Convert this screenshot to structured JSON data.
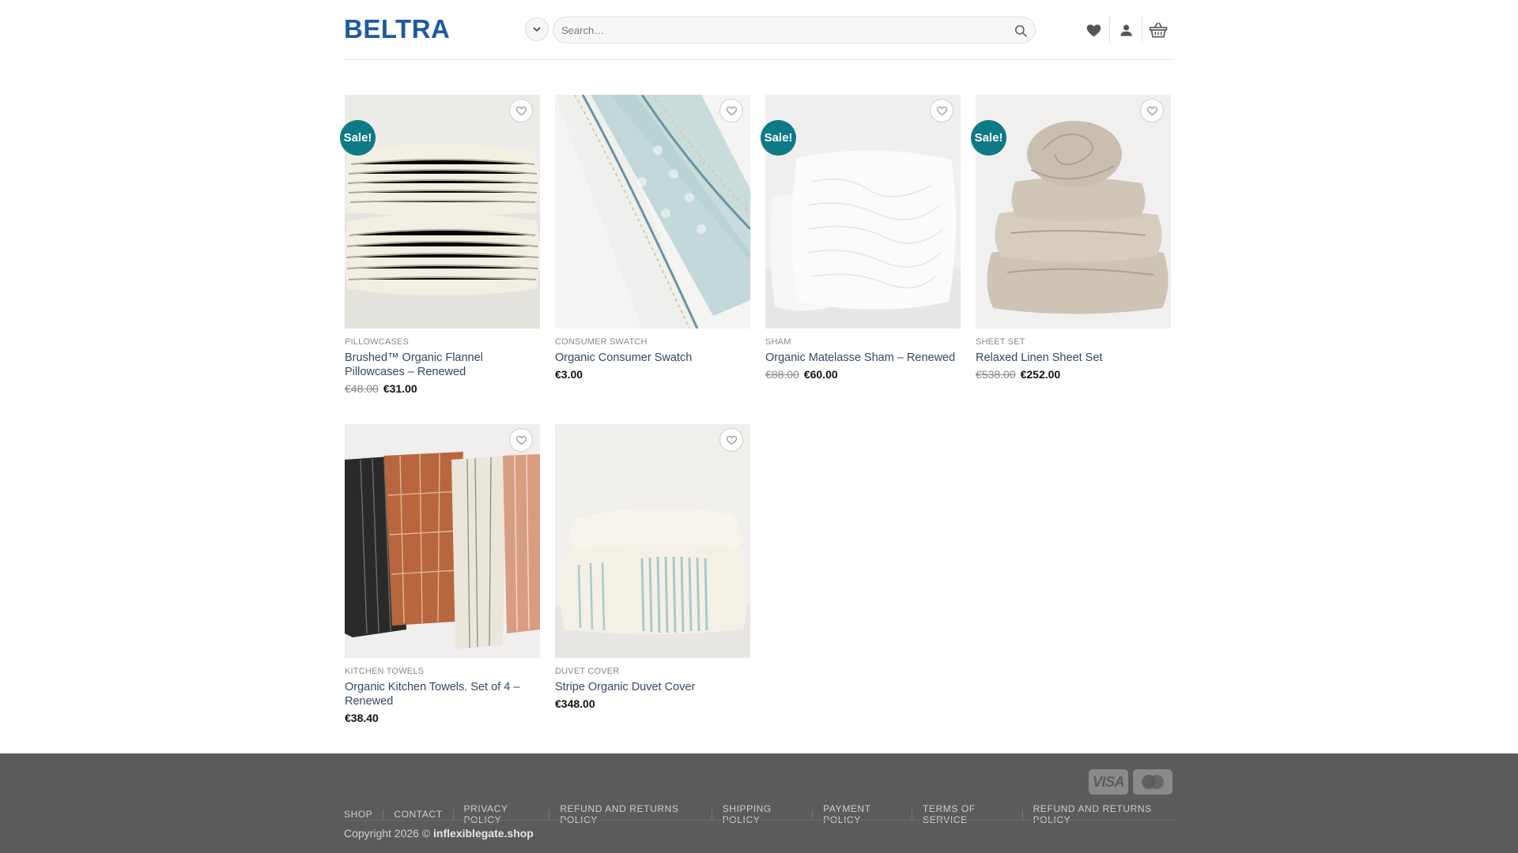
{
  "header": {
    "logo": "BELTRA",
    "search_placeholder": "Search…"
  },
  "products": [
    {
      "category": "PILLOWCASES",
      "title": "Brushed™ Organic Flannel Pillowcases – Renewed",
      "old_price": "€48.00",
      "price": "€31.00",
      "sale_label": "Sale!"
    },
    {
      "category": "CONSUMER SWATCH",
      "title": "Organic Consumer Swatch",
      "old_price": "",
      "price": "€3.00",
      "sale_label": ""
    },
    {
      "category": "SHAM",
      "title": "Organic Matelasse Sham – Renewed",
      "old_price": "€88.00",
      "price": "€60.00",
      "sale_label": "Sale!"
    },
    {
      "category": "SHEET SET",
      "title": "Relaxed Linen Sheet Set",
      "old_price": "€538.00",
      "price": "€252.00",
      "sale_label": "Sale!"
    },
    {
      "category": "KITCHEN TOWELS",
      "title": "Organic Kitchen Towels. Set of 4 – Renewed",
      "old_price": "",
      "price": "€38.40",
      "sale_label": ""
    },
    {
      "category": "DUVET COVER",
      "title": "Stripe Organic Duvet Cover",
      "old_price": "",
      "price": "€348.00",
      "sale_label": ""
    }
  ],
  "footer": {
    "payment": {
      "visa": "VISA"
    },
    "links": [
      "SHOP",
      "CONTACT",
      "PRIVACY POLICY",
      "REFUND AND RETURNS POLICY",
      "SHIPPING POLICY",
      "PAYMENT POLICY",
      "TERMS OF SERVICE",
      "REFUND AND RETURNS POLICY"
    ],
    "copyright_prefix": "Copyright 2026 ©",
    "copyright_site": "inflexiblegate.shop"
  },
  "colors": {
    "brand": "#1c5a9e",
    "sale_badge": "#0e7a86",
    "link": "#334862",
    "footer_bg": "#5b5b5b"
  },
  "icons": {
    "category_toggle": "chevron-down-icon",
    "search": "search-icon",
    "wishlist": "heart-icon",
    "account": "user-icon",
    "cart": "basket-icon"
  }
}
